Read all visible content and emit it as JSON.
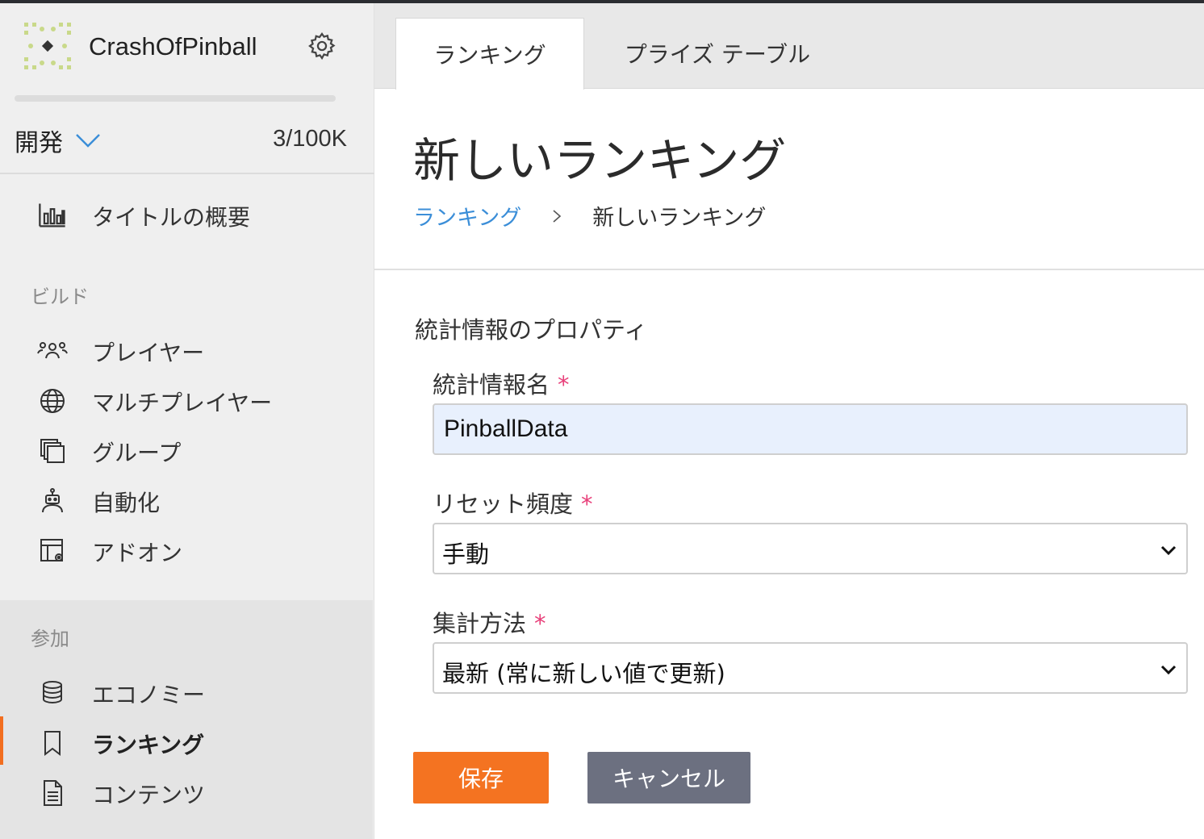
{
  "app": {
    "name": "CrashOfPinball"
  },
  "sidebar": {
    "environment": {
      "label": "開発",
      "usage": "3/100K"
    },
    "overview": {
      "label": "タイトルの概要",
      "icon": "bar-chart-icon"
    },
    "sections": [
      {
        "label": "ビルド",
        "items": [
          {
            "label": "プレイヤー",
            "icon": "players-icon"
          },
          {
            "label": "マルチプレイヤー",
            "icon": "globe-icon"
          },
          {
            "label": "グループ",
            "icon": "groups-icon"
          },
          {
            "label": "自動化",
            "icon": "robot-icon"
          },
          {
            "label": "アドオン",
            "icon": "addon-icon"
          }
        ]
      },
      {
        "label": "参加",
        "items": [
          {
            "label": "エコノミー",
            "icon": "coins-icon"
          },
          {
            "label": "ランキング",
            "icon": "bookmark-icon",
            "active": true
          },
          {
            "label": "コンテンツ",
            "icon": "document-icon"
          }
        ]
      }
    ]
  },
  "tabs": [
    {
      "label": "ランキング",
      "active": true
    },
    {
      "label": "プライズ テーブル",
      "active": false
    }
  ],
  "page": {
    "title": "新しいランキング",
    "breadcrumb": {
      "parent": "ランキング",
      "current": "新しいランキング"
    }
  },
  "form": {
    "section_title": "統計情報のプロパティ",
    "required_mark": "*",
    "stat_name": {
      "label": "統計情報名",
      "value": "PinballData"
    },
    "reset_frequency": {
      "label": "リセット頻度",
      "value": "手動"
    },
    "aggregation": {
      "label": "集計方法",
      "value": "最新 (常に新しい値で更新)"
    },
    "save_label": "保存",
    "cancel_label": "キャンセル"
  },
  "colors": {
    "accent": "#f47321",
    "link": "#3b8ed8",
    "required": "#e8407a",
    "cancel": "#6c7080"
  }
}
